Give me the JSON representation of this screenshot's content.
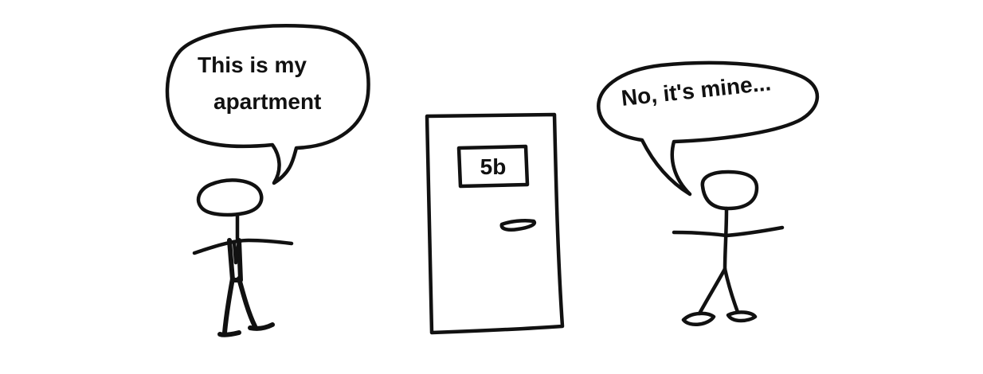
{
  "comic": {
    "left_speech": {
      "line1": "This is my",
      "line2": "apartment"
    },
    "right_speech": "No, it's mine...",
    "door_number": "5b"
  },
  "colors": {
    "ink": "#111111",
    "background": "#ffffff"
  }
}
